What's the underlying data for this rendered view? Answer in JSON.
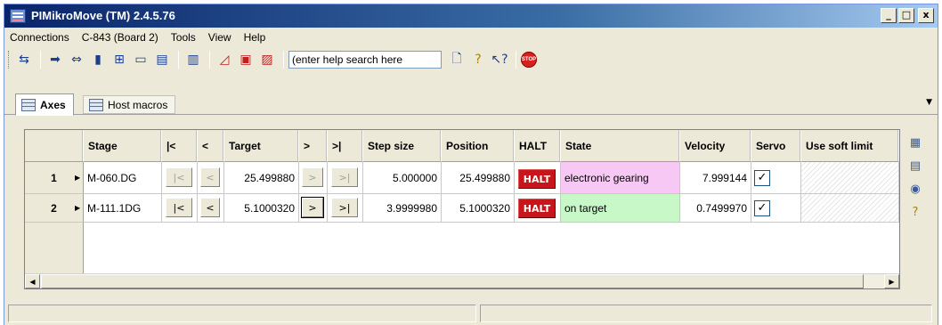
{
  "window": {
    "title": "PIMikroMove (TM)  2.4.5.76",
    "min": "_",
    "max": "□",
    "close": "x"
  },
  "menu": [
    "Connections",
    "C-843 (Board 2)",
    "Tools",
    "View",
    "Help"
  ],
  "toolbar": {
    "icons": [
      "connect-icon",
      "move-right-icon",
      "move-both-icon",
      "stop-axes-icon",
      "add-icon",
      "terminal-icon",
      "save-icon",
      "sequence-icon",
      "graph-icon",
      "scan-icon",
      "plot-icon"
    ],
    "help_search": "(enter help search here",
    "stop_label": "STOP"
  },
  "tabs": [
    {
      "label": "Axes",
      "active": true
    },
    {
      "label": "Host macros",
      "active": false
    }
  ],
  "table": {
    "headers": [
      "Stage",
      "|<",
      "<",
      "Target",
      ">",
      ">|",
      "Step size",
      "Position",
      "HALT",
      "State",
      "Velocity",
      "Servo",
      "Use soft limit"
    ],
    "rows": [
      {
        "index": "1",
        "stage": "M-060.DG",
        "to_start": "|<",
        "back": "<",
        "target": "25.499880",
        "fwd": ">",
        "to_end": ">|",
        "step": "5.000000",
        "position": "25.499880",
        "halt": "HALT",
        "state": "electronic gearing",
        "state_color": "#f8c8f4",
        "velocity": "7.999144",
        "servo": "✓"
      },
      {
        "index": "2",
        "stage": "M-111.1DG",
        "to_start": "|<",
        "back": "<",
        "target": "5.1000320",
        "fwd": ">",
        "to_end": ">|",
        "step": "3.9999980",
        "position": "5.1000320",
        "halt": "HALT",
        "state": "on target",
        "state_color": "#c8f7c8",
        "velocity": "0.7499970",
        "servo": "✓"
      }
    ]
  },
  "scrollbar": {
    "left": "◀",
    "right": "▶"
  }
}
